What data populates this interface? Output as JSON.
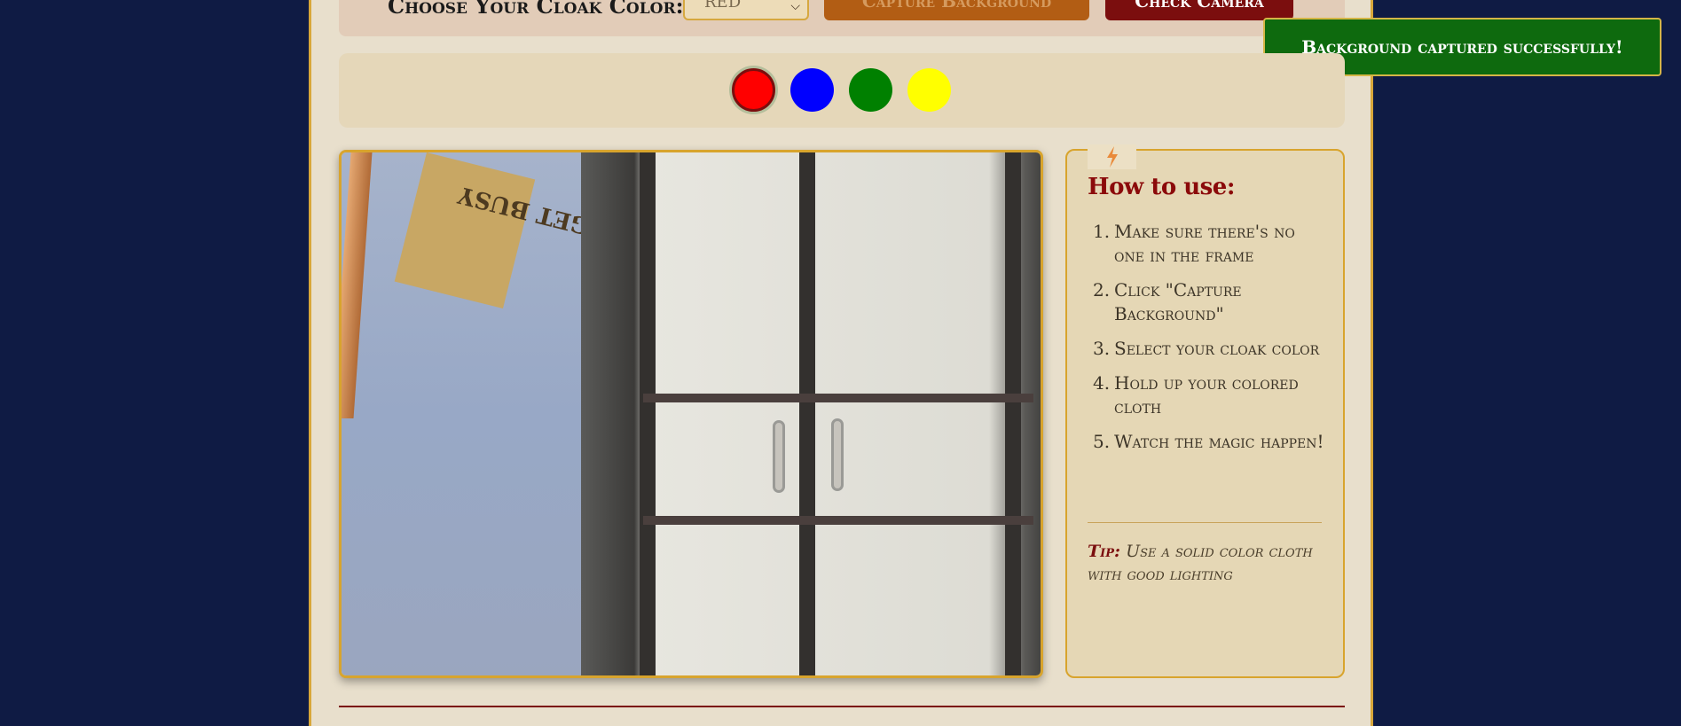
{
  "controls": {
    "choose_label": "Choose Your Cloak Color:",
    "select_value": "RED",
    "capture_label": "Capture Background",
    "check_camera_label": "Check Camera"
  },
  "toast": {
    "message": "Background captured successfully!"
  },
  "swatches": [
    {
      "name": "red",
      "color": "#ff0000",
      "selected": true
    },
    {
      "name": "blue",
      "color": "#0000ff",
      "selected": false
    },
    {
      "name": "green",
      "color": "#008000",
      "selected": false
    },
    {
      "name": "yellow",
      "color": "#ffff00",
      "selected": false
    }
  ],
  "camera": {
    "poster_text": "GET BUSY"
  },
  "sidebar": {
    "icon": "lightning-bolt-icon",
    "title": "How to use:",
    "steps": [
      "Make sure there's no one in the frame",
      "Click \"Capture Background\"",
      "Select your cloak color",
      "Hold up your colored cloth",
      "Watch the magic happen!"
    ],
    "tip_label": "Tip:",
    "tip_text": "Use a solid color cloth with good lighting"
  },
  "colors": {
    "page_bg": "#0f1b44",
    "accent_gold": "#d8a42d",
    "accent_red": "#7b0e0e",
    "toast_green": "#0e6a0e"
  }
}
